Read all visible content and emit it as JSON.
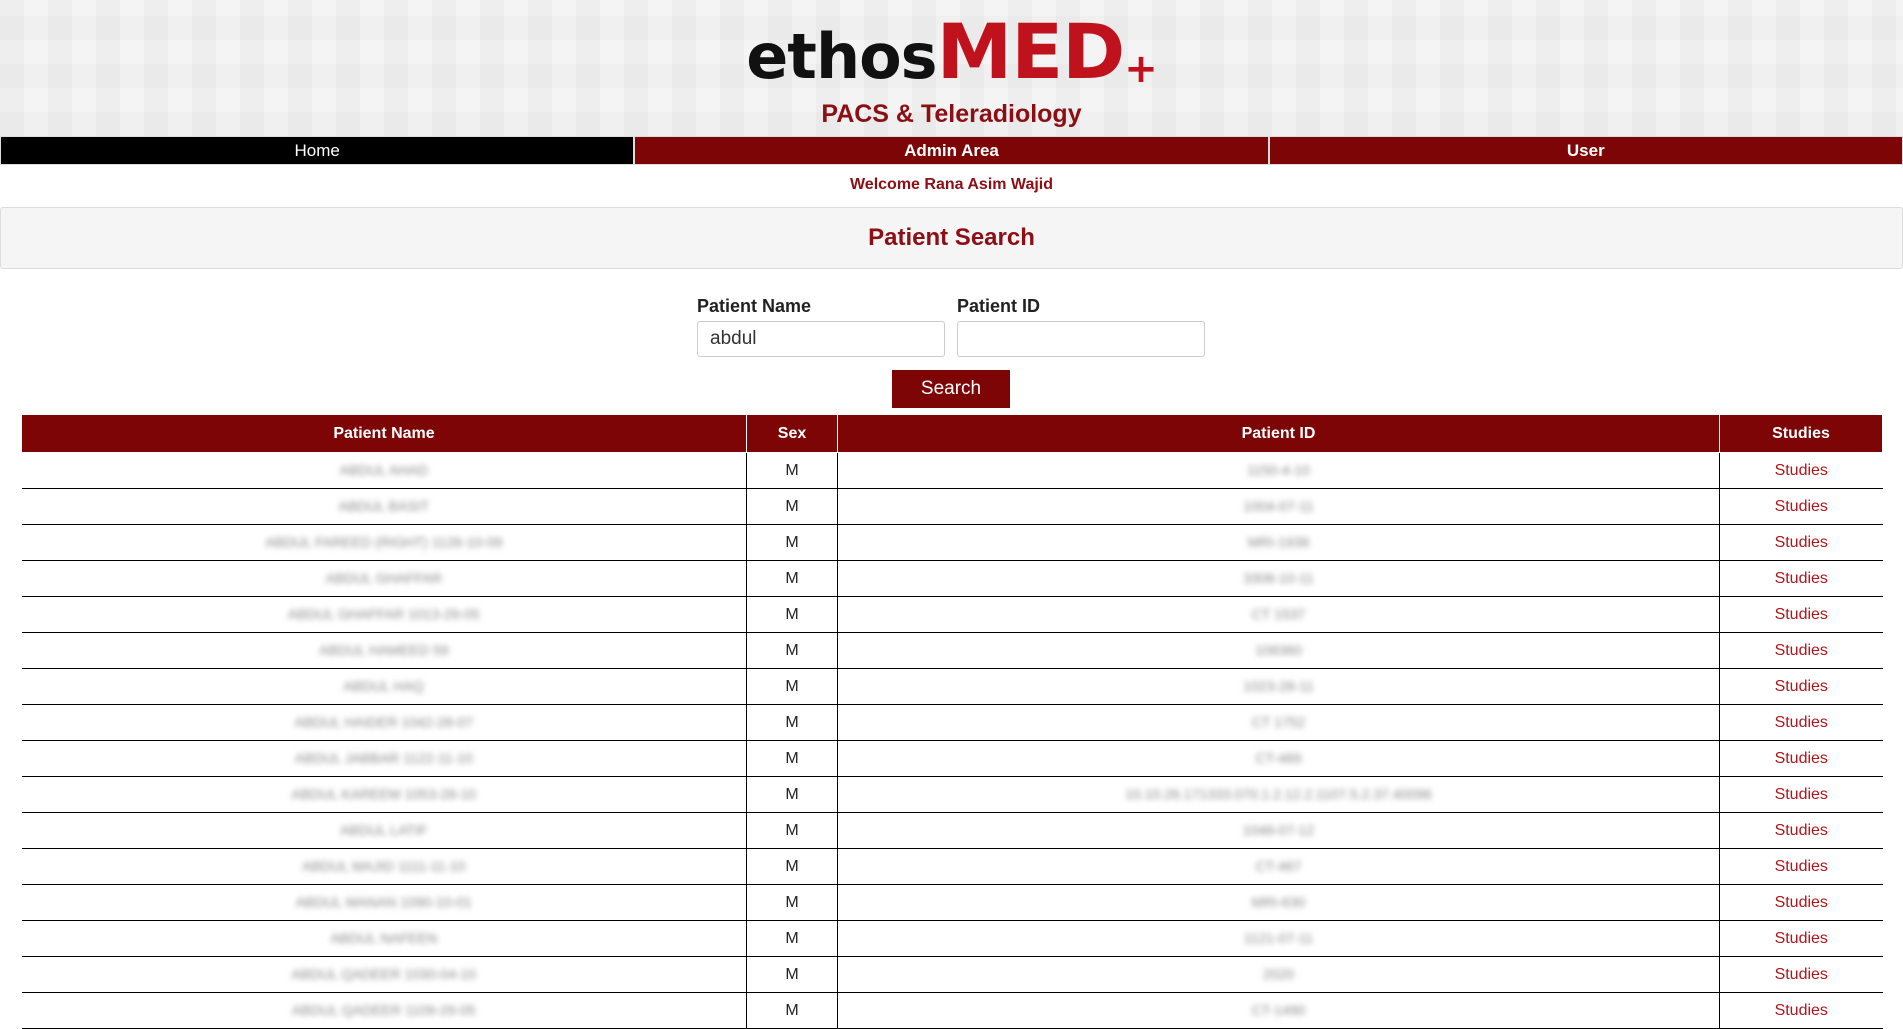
{
  "header": {
    "logo_ethos": "ethos",
    "logo_med": "MED",
    "logo_plus": "+",
    "subtitle": "PACS & Teleradiology"
  },
  "nav": {
    "home": "Home",
    "admin": "Admin Area",
    "user": "User"
  },
  "welcome": "Welcome Rana Asim Wajid",
  "panel": {
    "title": "Patient Search"
  },
  "search": {
    "name_label": "Patient Name",
    "name_value": "abdul",
    "id_label": "Patient ID",
    "id_value": "",
    "button": "Search"
  },
  "table": {
    "headers": [
      "Patient Name",
      "Sex",
      "Patient ID",
      "Studies"
    ],
    "rows": [
      {
        "name": "ABDUL AHAD",
        "sex": "M",
        "id": "1150-4-10",
        "studies": "Studies"
      },
      {
        "name": "ABDUL BASIT",
        "sex": "M",
        "id": "1004-07-11",
        "studies": "Studies"
      },
      {
        "name": "ABDUL FAREED (RIGHT) 1126-10-09",
        "sex": "M",
        "id": "MRI-1938",
        "studies": "Studies"
      },
      {
        "name": "ABDUL GHAFFAR",
        "sex": "M",
        "id": "3308-10-11",
        "studies": "Studies"
      },
      {
        "name": "ABDUL GHAFFAR 1013-29-05",
        "sex": "M",
        "id": "CT 1537",
        "studies": "Studies"
      },
      {
        "name": "ABDUL HAMEED 59",
        "sex": "M",
        "id": "108360",
        "studies": "Studies"
      },
      {
        "name": "ABDUL HAQ",
        "sex": "M",
        "id": "1023-28-11",
        "studies": "Studies"
      },
      {
        "name": "ABDUL HAIDER 1042-28-07",
        "sex": "M",
        "id": "CT 1752",
        "studies": "Studies"
      },
      {
        "name": "ABDUL JABBAR 1122-11-10",
        "sex": "M",
        "id": "CT-469",
        "studies": "Studies"
      },
      {
        "name": "ABDUL KAREEM 1053-28-10",
        "sex": "M",
        "id": "10.10.26.171333.070.1.2.12.2.1107.5.2.37.40096",
        "studies": "Studies"
      },
      {
        "name": "ABDUL LATIF",
        "sex": "M",
        "id": "1048-07-12",
        "studies": "Studies"
      },
      {
        "name": "ABDUL MAJID 1111-11-10",
        "sex": "M",
        "id": "CT-467",
        "studies": "Studies"
      },
      {
        "name": "ABDUL MANAN 1090-10-01",
        "sex": "M",
        "id": "MRI-630",
        "studies": "Studies"
      },
      {
        "name": "ABDUL NAFEEN",
        "sex": "M",
        "id": "1121-07-11",
        "studies": "Studies"
      },
      {
        "name": "ABDUL QADEER 1030-04-10",
        "sex": "M",
        "id": "2020",
        "studies": "Studies"
      },
      {
        "name": "ABDUL QADEER 1109-29-05",
        "sex": "M",
        "id": "CT-1490",
        "studies": "Studies"
      }
    ]
  }
}
